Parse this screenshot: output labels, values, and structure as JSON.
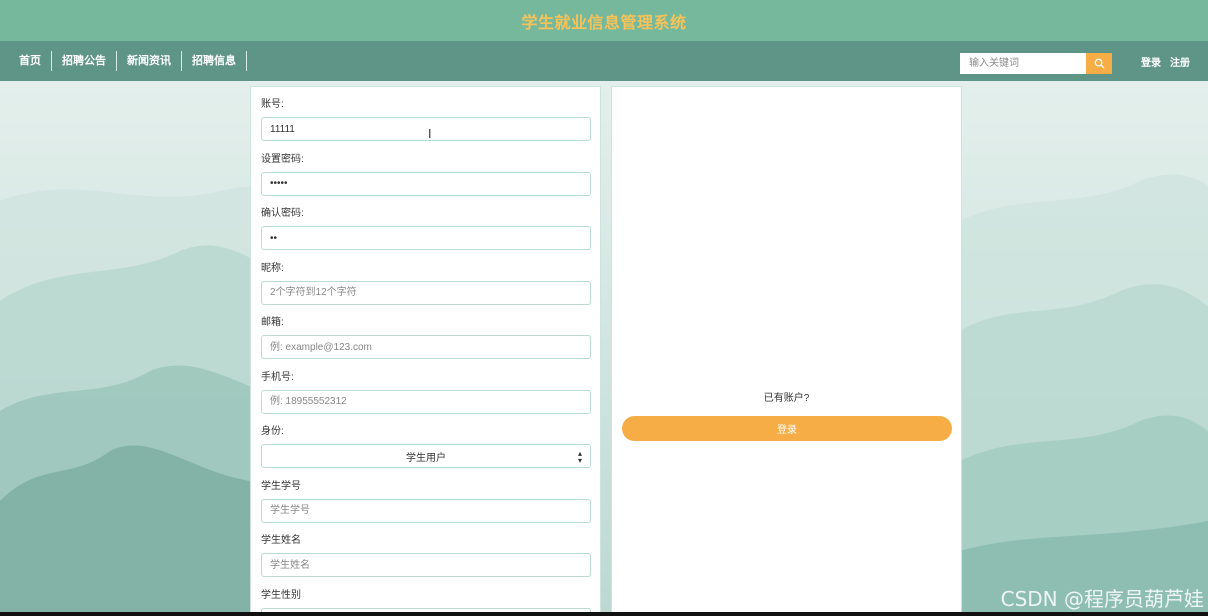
{
  "header": {
    "title": "学生就业信息管理系统"
  },
  "nav": {
    "items": [
      "首页",
      "招聘公告",
      "新闻资讯",
      "招聘信息"
    ],
    "search_placeholder": "输入关键词",
    "login_label": "登录",
    "register_label": "注册"
  },
  "form": {
    "fields": [
      {
        "label": "账号:",
        "value": "11111",
        "placeholder": ""
      },
      {
        "label": "设置密码:",
        "value": "•••••",
        "placeholder": ""
      },
      {
        "label": "确认密码:",
        "value": "••",
        "placeholder": ""
      },
      {
        "label": "昵称:",
        "value": "",
        "placeholder": "2个字符到12个字符"
      },
      {
        "label": "邮箱:",
        "value": "",
        "placeholder": "例: example@123.com"
      },
      {
        "label": "手机号:",
        "value": "",
        "placeholder": "例: 18955552312"
      }
    ],
    "role": {
      "label": "身份:",
      "selected": "学生用户"
    },
    "student_fields": [
      {
        "label": "学生学号",
        "placeholder": "学生学号"
      },
      {
        "label": "学生姓名",
        "placeholder": "学生姓名"
      },
      {
        "label": "学生性别",
        "placeholder": ""
      }
    ]
  },
  "side": {
    "has_account_text": "已有账户?",
    "login_button": "登录"
  },
  "watermark": "CSDN @程序员葫芦娃",
  "colors": {
    "accent": "#f6ad46",
    "topbar": "#76b89c",
    "navbar": "#5f9586",
    "title": "#f6c35a"
  }
}
